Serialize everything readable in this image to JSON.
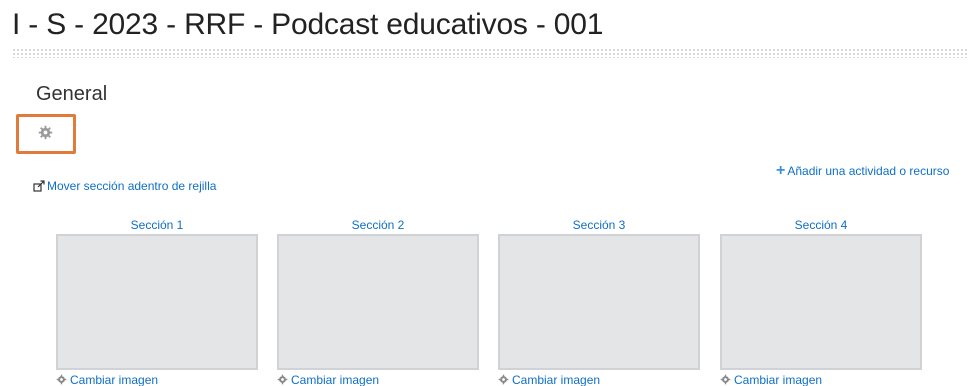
{
  "course": {
    "title": "I - S - 2023 - RRF - Podcast educativos - 001"
  },
  "section": {
    "name": "General"
  },
  "links": {
    "add_activity": "Añadir una actividad o recurso",
    "move_section": "Mover sección adentro de rejilla"
  },
  "tiles": [
    {
      "title": "Sección 1",
      "change_image": "Cambiar imagen"
    },
    {
      "title": "Sección 2",
      "change_image": "Cambiar imagen"
    },
    {
      "title": "Sección 3",
      "change_image": "Cambiar imagen"
    },
    {
      "title": "Sección 4",
      "change_image": "Cambiar imagen"
    }
  ],
  "colors": {
    "link": "#0f6fc5",
    "highlight": "#e07b39",
    "tile_bg": "#e4e5e7"
  },
  "icons": {
    "settings": "gear-icon",
    "add": "plus-icon",
    "move": "move-icon",
    "change_image": "gear-icon"
  }
}
